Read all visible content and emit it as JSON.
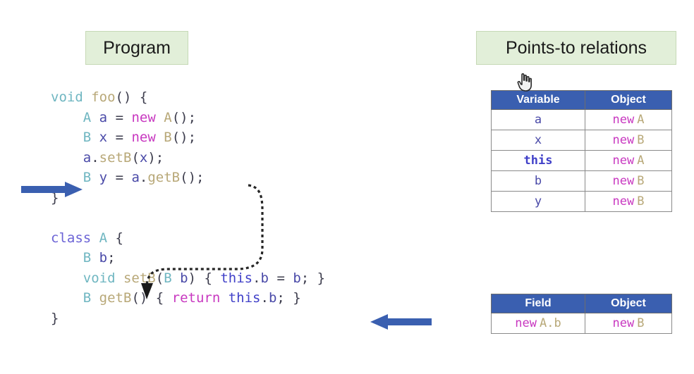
{
  "headings": {
    "program": "Program",
    "points_to": "Points-to relations"
  },
  "code": {
    "language": "java",
    "lines": [
      {
        "id": "foo-signature",
        "tokens": [
          {
            "text": "void",
            "kind": "type"
          },
          {
            "text": " ",
            "kind": "plain"
          },
          {
            "text": "foo",
            "kind": "fn"
          },
          {
            "text": "() {",
            "kind": "punct"
          }
        ]
      },
      {
        "id": "alloc-a",
        "tokens": [
          {
            "text": "    ",
            "kind": "plain"
          },
          {
            "text": "A",
            "kind": "type"
          },
          {
            "text": " ",
            "kind": "plain"
          },
          {
            "text": "a",
            "kind": "var"
          },
          {
            "text": " = ",
            "kind": "punct"
          },
          {
            "text": "new",
            "kind": "new"
          },
          {
            "text": " ",
            "kind": "plain"
          },
          {
            "text": "A",
            "kind": "fn"
          },
          {
            "text": "();",
            "kind": "punct"
          }
        ]
      },
      {
        "id": "alloc-x",
        "tokens": [
          {
            "text": "    ",
            "kind": "plain"
          },
          {
            "text": "B",
            "kind": "type"
          },
          {
            "text": " ",
            "kind": "plain"
          },
          {
            "text": "x",
            "kind": "var"
          },
          {
            "text": " = ",
            "kind": "punct"
          },
          {
            "text": "new",
            "kind": "new"
          },
          {
            "text": " ",
            "kind": "plain"
          },
          {
            "text": "B",
            "kind": "fn"
          },
          {
            "text": "();",
            "kind": "punct"
          }
        ]
      },
      {
        "id": "call-setb",
        "tokens": [
          {
            "text": "    ",
            "kind": "plain"
          },
          {
            "text": "a",
            "kind": "var"
          },
          {
            "text": ".",
            "kind": "punct"
          },
          {
            "text": "setB",
            "kind": "fn"
          },
          {
            "text": "(",
            "kind": "punct"
          },
          {
            "text": "x",
            "kind": "var"
          },
          {
            "text": ");",
            "kind": "punct"
          }
        ]
      },
      {
        "id": "call-getb",
        "tokens": [
          {
            "text": "    ",
            "kind": "plain"
          },
          {
            "text": "B",
            "kind": "type"
          },
          {
            "text": " ",
            "kind": "plain"
          },
          {
            "text": "y",
            "kind": "var"
          },
          {
            "text": " = ",
            "kind": "punct"
          },
          {
            "text": "a",
            "kind": "var"
          },
          {
            "text": ".",
            "kind": "punct"
          },
          {
            "text": "getB",
            "kind": "fn"
          },
          {
            "text": "();",
            "kind": "punct"
          }
        ]
      },
      {
        "id": "foo-close",
        "tokens": [
          {
            "text": "}",
            "kind": "punct"
          }
        ]
      },
      {
        "id": "blank-1",
        "tokens": [
          {
            "text": " ",
            "kind": "plain"
          }
        ]
      },
      {
        "id": "class-a",
        "tokens": [
          {
            "text": "class",
            "kind": "kw"
          },
          {
            "text": " ",
            "kind": "plain"
          },
          {
            "text": "A",
            "kind": "type"
          },
          {
            "text": " {",
            "kind": "punct"
          }
        ]
      },
      {
        "id": "field-b",
        "tokens": [
          {
            "text": "    ",
            "kind": "plain"
          },
          {
            "text": "B",
            "kind": "type"
          },
          {
            "text": " ",
            "kind": "plain"
          },
          {
            "text": "b",
            "kind": "var"
          },
          {
            "text": ";",
            "kind": "punct"
          }
        ]
      },
      {
        "id": "method-setb",
        "tokens": [
          {
            "text": "    ",
            "kind": "plain"
          },
          {
            "text": "void",
            "kind": "type"
          },
          {
            "text": " ",
            "kind": "plain"
          },
          {
            "text": "setB",
            "kind": "fn"
          },
          {
            "text": "(",
            "kind": "punct"
          },
          {
            "text": "B",
            "kind": "type"
          },
          {
            "text": " ",
            "kind": "plain"
          },
          {
            "text": "b",
            "kind": "var"
          },
          {
            "text": ") { ",
            "kind": "punct"
          },
          {
            "text": "this",
            "kind": "this"
          },
          {
            "text": ".",
            "kind": "punct"
          },
          {
            "text": "b",
            "kind": "var"
          },
          {
            "text": " = ",
            "kind": "punct"
          },
          {
            "text": "b",
            "kind": "var"
          },
          {
            "text": "; }",
            "kind": "punct"
          }
        ]
      },
      {
        "id": "method-getb",
        "tokens": [
          {
            "text": "    ",
            "kind": "plain"
          },
          {
            "text": "B",
            "kind": "type"
          },
          {
            "text": " ",
            "kind": "plain"
          },
          {
            "text": "getB",
            "kind": "fn"
          },
          {
            "text": "() { ",
            "kind": "punct"
          },
          {
            "text": "return",
            "kind": "new"
          },
          {
            "text": " ",
            "kind": "plain"
          },
          {
            "text": "this",
            "kind": "this"
          },
          {
            "text": ".",
            "kind": "punct"
          },
          {
            "text": "b",
            "kind": "var"
          },
          {
            "text": "; }",
            "kind": "punct"
          }
        ]
      },
      {
        "id": "class-close",
        "tokens": [
          {
            "text": "}",
            "kind": "punct"
          }
        ]
      }
    ]
  },
  "tables": {
    "variables": {
      "name": "points-to-variables",
      "columns": [
        "Variable",
        "Object"
      ],
      "rows": [
        {
          "variable": "a",
          "object_new": "new",
          "object_type": "A"
        },
        {
          "variable": "x",
          "object_new": "new",
          "object_type": "B"
        },
        {
          "variable": "this",
          "object_new": "new",
          "object_type": "A"
        },
        {
          "variable": "b",
          "object_new": "new",
          "object_type": "B"
        },
        {
          "variable": "y",
          "object_new": "new",
          "object_type": "B"
        }
      ]
    },
    "fields": {
      "name": "points-to-fields",
      "columns": [
        "Field",
        "Object"
      ],
      "rows": [
        {
          "field_new": "new",
          "field_path": "A.b",
          "object_new": "new",
          "object_type": "B"
        }
      ]
    }
  },
  "annotations": {
    "current_statement_arrow": "current-statement-marker",
    "return_statement_arrow": "return-statement-marker",
    "call_flow_curve": "getB-to-setB-call-flow",
    "cursor": "hand-pointer-cursor"
  },
  "colors": {
    "chip_background": "#e2efd9",
    "chip_border": "#c6d9b6",
    "table_header": "#3a5fb0",
    "arrow_blue": "#3a5fb0",
    "token_keyword": "#6b63d6",
    "token_type": "#6fb6c1",
    "token_function": "#b8a878",
    "token_variable": "#4a4aa8",
    "token_new": "#c838c0",
    "token_this": "#4040c8",
    "token_punct": "#3d3d4d"
  }
}
